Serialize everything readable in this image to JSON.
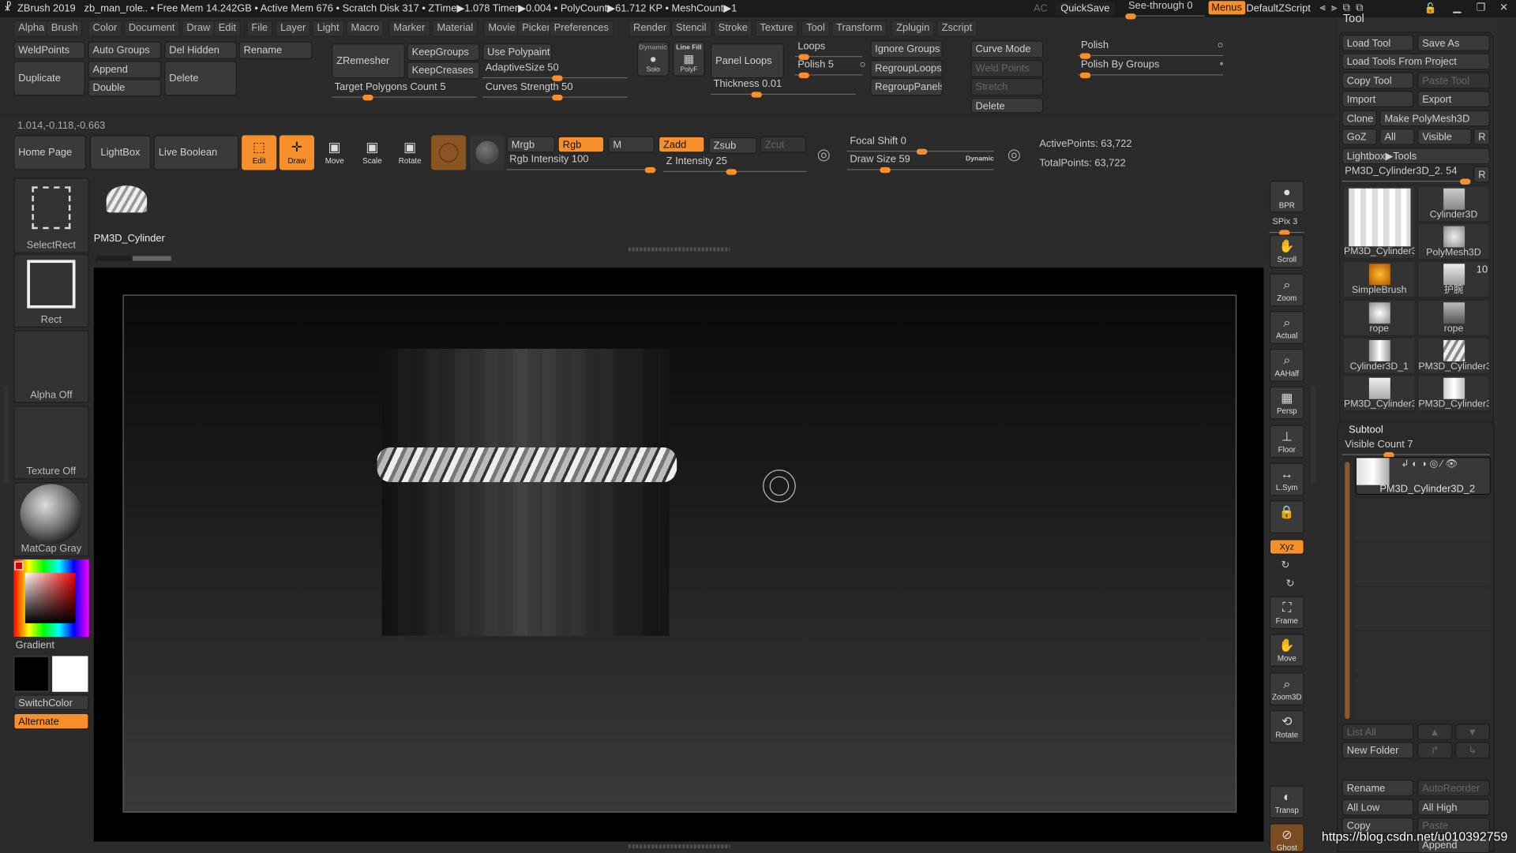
{
  "titlebar": {
    "app": "ZBrush 2019",
    "file": "zb_man_role",
    "stats": ".. • Free Mem 14.242GB • Active Mem 676 • Scratch Disk 317 •  ZTime▶1.078 Timer▶0.004 • PolyCount▶61.712 KP  • MeshCount▶1",
    "ac": "AC",
    "quicksave": "QuickSave",
    "see_through": "See-through  0",
    "see_through_value": 0,
    "menus": "Menus",
    "default_zscript": "DefaultZScript"
  },
  "menubar": [
    "Alpha",
    "Brush",
    "Color",
    "Document",
    "Draw",
    "Edit",
    "File",
    "Layer",
    "Light",
    "Macro",
    "Marker",
    "Material",
    "Movie",
    "Picker",
    "Preferences",
    "Render",
    "Stencil",
    "Stroke",
    "Texture",
    "Tool",
    "Transform",
    "Zplugin",
    "Zscript"
  ],
  "geometry": {
    "weldpoints": "WeldPoints",
    "auto_groups": "Auto Groups",
    "del_hidden": "Del Hidden",
    "rename": "Rename",
    "duplicate": "Duplicate",
    "append": "Append",
    "double": "Double",
    "delete": "Delete"
  },
  "zremesher": {
    "zremesher": "ZRemesher",
    "keepgroups": "KeepGroups",
    "keepcreases": "KeepCreases",
    "use_polypaint": "Use Polypaint",
    "adaptive_size": "AdaptiveSize 50",
    "target_polygons": "Target Polygons Count 5",
    "curves_strength": "Curves Strength 50"
  },
  "display": {
    "dynamic": "Dynamic",
    "solo": "Solo",
    "line_fill": "Line Fill",
    "polyf": "PolyF"
  },
  "panel_loops": {
    "panel_loops": "Panel Loops",
    "thickness": "Thickness 0.01",
    "loops": "Loops",
    "polish": "Polish 5",
    "ignore_groups": "Ignore Groups",
    "regroup_loops": "RegroupLoops",
    "regroup_panels": "RegroupPanels"
  },
  "curve": {
    "curve_mode": "Curve Mode",
    "weld_points": "Weld Points",
    "stretch": "Stretch",
    "delete": "Delete"
  },
  "polish": {
    "polish": "Polish",
    "polish_by_groups": "Polish By Groups"
  },
  "coords": "1.014,-0.118,-0.663",
  "toolbar": {
    "home_page": "Home Page",
    "lightbox": "LightBox",
    "live_boolean": "Live Boolean",
    "edit": "Edit",
    "draw": "Draw",
    "move": "Move",
    "scale": "Scale",
    "rotate": "Rotate",
    "mrgb": "Mrgb",
    "rgb": "Rgb",
    "m": "M",
    "zadd": "Zadd",
    "zsub": "Zsub",
    "zcut": "Zcut",
    "rgb_intensity": "Rgb Intensity 100",
    "z_intensity": "Z Intensity 25",
    "focal_shift": "Focal Shift 0",
    "draw_size": "Draw Size 59",
    "dynamic": "Dynamic",
    "active_points": "ActivePoints: 63,722",
    "total_points": "TotalPoints: 63,722"
  },
  "slider_values": {
    "adaptive_size": 50,
    "target_polygons": 5,
    "curves_strength": 50,
    "thickness": 0.01,
    "polish": 5,
    "rgb_intensity": 100,
    "z_intensity": 25,
    "focal_shift": 0,
    "draw_size": 59,
    "visible_count": 7
  },
  "left_shelf": {
    "select_rect": "SelectRect",
    "rect": "Rect",
    "alpha": "Alpha Off",
    "texture": "Texture Off",
    "material": "MatCap Gray",
    "gradient": "Gradient",
    "switch_color": "SwitchColor",
    "alternate": "Alternate"
  },
  "current_brush": "PM3D_Cylinder",
  "right_toolbar": [
    "BPR",
    "SPix 3",
    "Scroll",
    "Zoom",
    "Actual",
    "AAHalf",
    "Persp",
    "Floor",
    "L.Sym",
    "Xyz",
    "Frame",
    "Move",
    "Zoom3D",
    "Rotate",
    "Transp",
    "Ghost"
  ],
  "tool_panel": {
    "title": "Tool",
    "load_tool": "Load Tool",
    "save_as": "Save As",
    "load_from_project": "Load Tools From Project",
    "copy_tool": "Copy Tool",
    "paste_tool": "Paste Tool",
    "import": "Import",
    "export": "Export",
    "clone": "Clone",
    "make_polymesh": "Make PolyMesh3D",
    "goz": "GoZ",
    "all": "All",
    "visible": "Visible",
    "r": "R",
    "lightbox_tools": "Lightbox▶Tools",
    "current_tool": "PM3D_Cylinder3D_2. 54",
    "thumbnails": [
      "PM3D_Cylinder3",
      "Cylinder3D",
      "PolyMesh3D",
      "SimpleBrush",
      "护腕",
      "rope",
      "rope",
      "Cylinder3D_1",
      "PM3D_Cylinder3",
      "PM3D_Cylinder3",
      "PM3D_Cylinder3"
    ],
    "badge": "10"
  },
  "subtool": {
    "title": "Subtool",
    "visible_count": "Visible Count 7",
    "item": "PM3D_Cylinder3D_2",
    "list_all": "List All",
    "new_folder": "New Folder",
    "rename": "Rename",
    "auto_reorder": "AutoReorder",
    "all_low": "All Low",
    "all_high": "All High",
    "copy": "Copy",
    "paste": "Paste",
    "append": "Append"
  },
  "watermark": "https://blog.csdn.net/u010392759",
  "colors": {
    "accent": "#f7902a",
    "background": "#2b2b2b",
    "canvas": "#000000"
  }
}
